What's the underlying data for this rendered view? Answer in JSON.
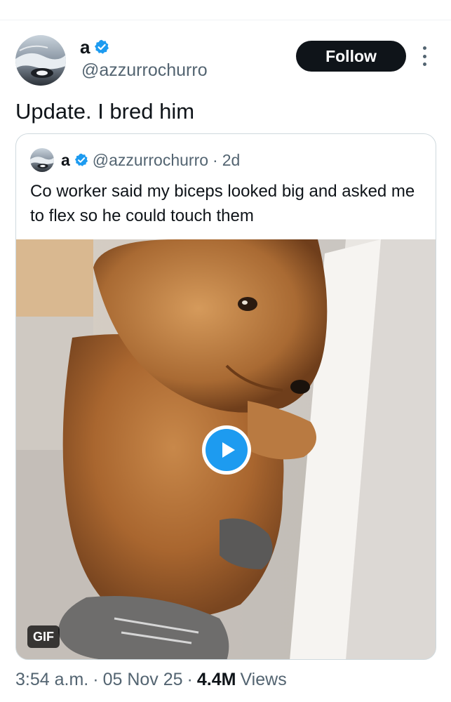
{
  "author": {
    "display_name": "a",
    "handle": "@azzurrochurro",
    "verified": true,
    "avatar_icon": "avatar-image"
  },
  "follow_label": "Follow",
  "tweet": {
    "text": "Update. I bred him",
    "time": "3:54 a.m.",
    "separator": "·",
    "date": "05 Nov 25",
    "views_count": "4.4M",
    "views_label": "Views"
  },
  "quote": {
    "display_name": "a",
    "handle": "@azzurrochurro",
    "separator": "·",
    "age": "2d",
    "text": "Co worker said my biceps looked big and asked me to flex so he could touch them",
    "media_badge": "GIF"
  },
  "colors": {
    "accent": "#1d9bf0",
    "text_primary": "#0f1419",
    "text_secondary": "#536471",
    "border": "#cfd9de",
    "follow_bg": "#0f1419"
  }
}
